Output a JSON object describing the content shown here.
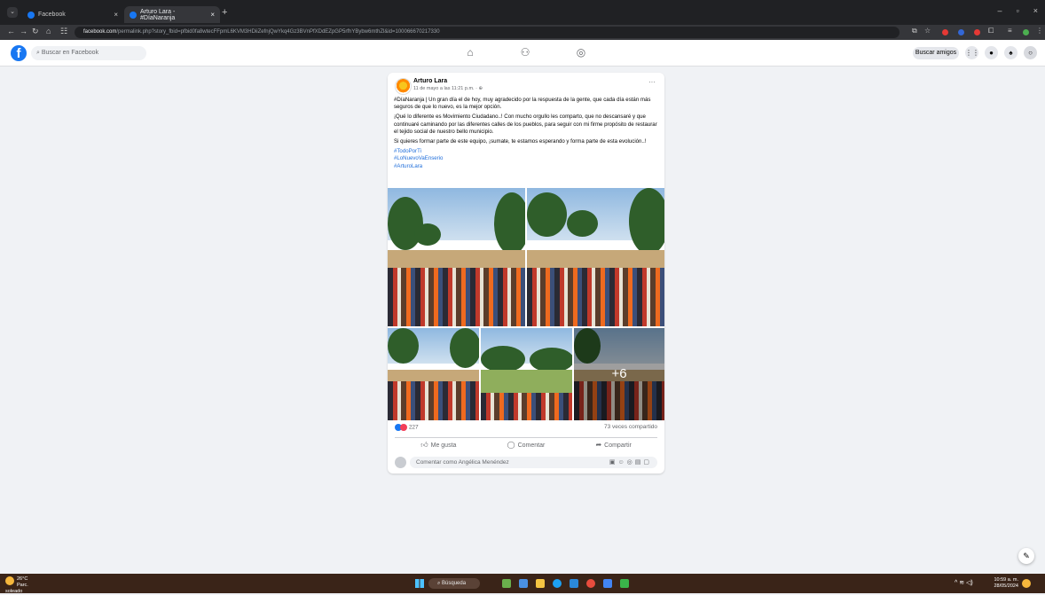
{
  "browser": {
    "tabs": [
      {
        "title": "Facebook",
        "active": false
      },
      {
        "title": "Arturo Lara - #DíaNaranja",
        "active": true
      }
    ],
    "url_domain": "facebook.com",
    "url_path": "/permalink.php?story_fbid=pfbid0fa8wtecFFpmL6KVM3HDiiZefnjQwYkq4Gz3BVnPfXDdEZpGP5rfhYBybw6mthZl&id=100066670217330"
  },
  "fb_header": {
    "search_placeholder": "Buscar en Facebook",
    "find_friends_label": "Buscar amigos"
  },
  "post": {
    "author": "Arturo Lara",
    "timestamp": "11 de mayo a las 11:21 p.m. ·",
    "more_icon": "···",
    "line1": "#DíaNaranja | Un gran día el de hoy, muy agradecido por la respuesta de la gente, que cada día están más seguros de que lo nuevo, es la mejor opción.",
    "line2": "¡Qué lo diferente es Movimiento Ciudadano..! Con mucho orgullo les comparto, que no descansaré y que continuaré caminando por las diferentes calles de los pueblos, para seguir con mi firme propósito de restaurar el tejido social de nuestro bello municipio.",
    "line3": "Si quieres formar parte de este equipo, ¡sumate, te estamos esperando y forma parte de esta evolución..!",
    "hashtags": [
      "#TodoPorTi",
      "#LoNuevoVaEnserio",
      "#ArturoLara"
    ],
    "more_photos": "+6",
    "reactions_count": "227",
    "shares": "73 veces compartido",
    "like_label": "Me gusta",
    "comment_label": "Comentar",
    "share_label": "Compartir",
    "comment_placeholder": "Comentar como Angélica Menéndez"
  },
  "taskbar": {
    "temperature": "26°C",
    "weather_desc": "Parc. soleado",
    "search_label": "Búsqueda",
    "time": "10:59 a. m.",
    "date": "28/05/2024"
  }
}
